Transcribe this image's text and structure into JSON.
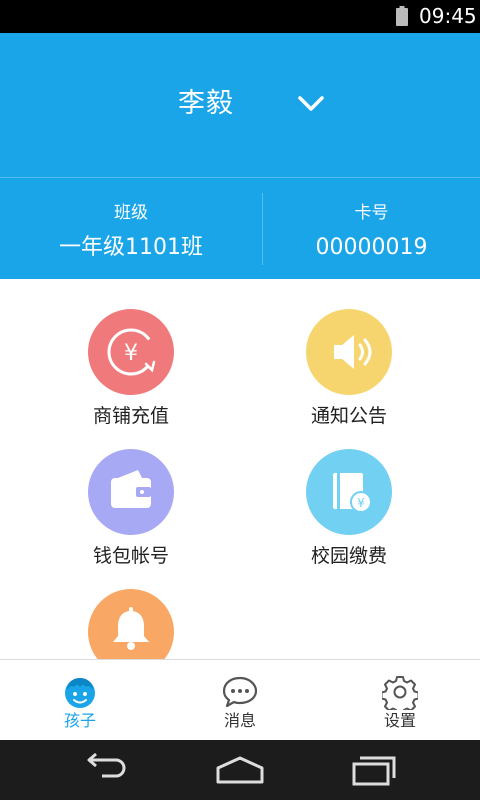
{
  "status_bar": {
    "time": "09:45"
  },
  "header": {
    "child_name": "李毅",
    "class_label": "班级",
    "class_value": "一年级1101班",
    "card_label": "卡号",
    "card_value": "00000019"
  },
  "menu": [
    {
      "label": "商铺充值",
      "icon": "yuan-recharge-icon",
      "color": "#f07a7b"
    },
    {
      "label": "通知公告",
      "icon": "speaker-icon",
      "color": "#f7d56e"
    },
    {
      "label": "钱包帐号",
      "icon": "wallet-icon",
      "color": "#a8a9f5"
    },
    {
      "label": "校园缴费",
      "icon": "book-yuan-icon",
      "color": "#72d0f2"
    },
    {
      "label": "",
      "icon": "bell-icon",
      "color": "#f8a765"
    }
  ],
  "tabs": [
    {
      "label": "孩子",
      "icon": "child-face-icon",
      "active": true
    },
    {
      "label": "消息",
      "icon": "chat-bubble-icon",
      "active": false
    },
    {
      "label": "设置",
      "icon": "gear-icon",
      "active": false
    }
  ],
  "colors": {
    "brand": "#1aa5e9",
    "status_bar": "#000000",
    "nav_bar": "#1c1c1c"
  }
}
